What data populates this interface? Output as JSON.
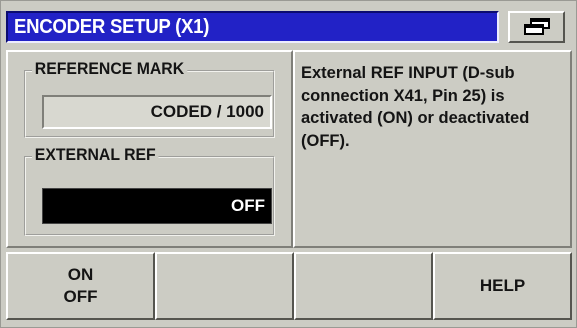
{
  "header": {
    "title": "ENCODER SETUP (X1)",
    "window_icon": "window-toggle-icon"
  },
  "left": {
    "reference_mark": {
      "label": "REFERENCE MARK",
      "value": "CODED  /  1000"
    },
    "external_ref": {
      "label": "EXTERNAL REF",
      "value": "OFF"
    }
  },
  "help_text": "External REF INPUT (D-sub connection X41, Pin 25) is activated (ON) or deactivated (OFF).",
  "softkeys": {
    "k1_line1": "ON",
    "k1_line2": "OFF",
    "k2": "",
    "k3": "",
    "k4": "HELP"
  },
  "colors": {
    "title_bar": "#2222c6",
    "background": "#ccccc4",
    "selected_field": "#000000"
  }
}
